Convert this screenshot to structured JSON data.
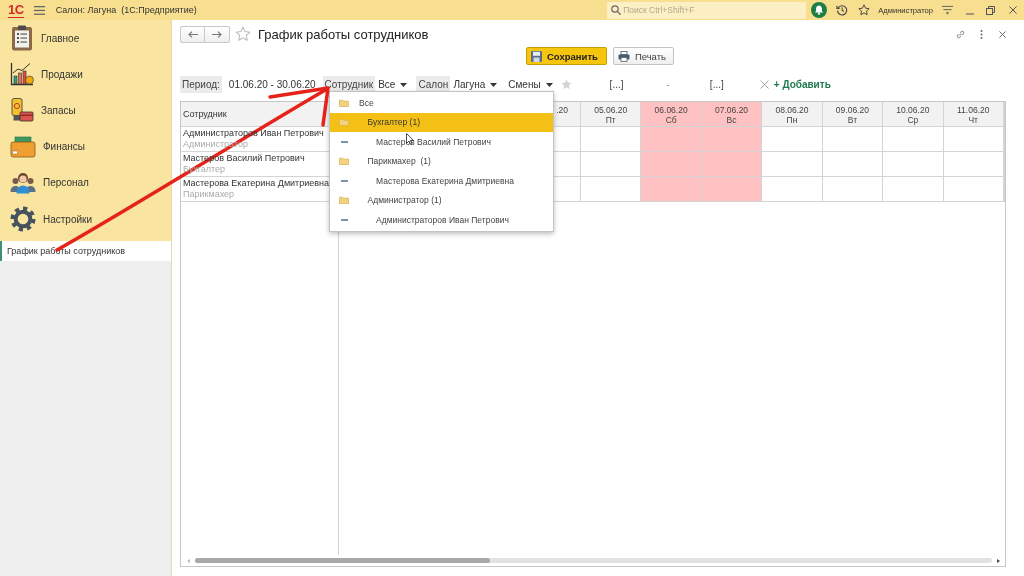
{
  "app_bar": {
    "logo": "1С",
    "title": "Салон: Лагуна  (1С:Предприятие)",
    "search": {
      "placeholder": "Поиск Ctrl+Shift+F"
    },
    "user": "Администратор"
  },
  "sections": [
    {
      "label": "Главное"
    },
    {
      "label": "Продажи"
    },
    {
      "label": "Запасы"
    },
    {
      "label": "Финансы"
    },
    {
      "label": "Персонал"
    },
    {
      "label": "Настройки"
    }
  ],
  "open_pages": [
    {
      "label": "График работы сотрудников",
      "selected": true
    }
  ],
  "form": {
    "title": "График работы сотрудников",
    "buttons": [
      {
        "label": "Сохранить",
        "kind": "save"
      },
      {
        "label": "Печать",
        "kind": "print"
      }
    ],
    "period": {
      "label": "Период:",
      "value": "01.06.20 - 30.06.20"
    },
    "selects": [
      {
        "label": "Сотрудник",
        "value": "Все"
      },
      {
        "label": "Салон",
        "value": "Лагуна"
      }
    ],
    "shifts_menu": "Смены",
    "range": {
      "from": "[...]",
      "separator": "-",
      "to": "[...]"
    },
    "add_link": "+ Добавить",
    "table": {
      "employee_header": "Сотрудник",
      "columns": [
        {
          "date": ".20",
          "kind": "partial",
          "weekend": false
        },
        {
          "date": "05.06.20",
          "day": "Пт",
          "kind": "day",
          "weekend": false
        },
        {
          "date": "06.06.20",
          "day": "Сб",
          "kind": "day",
          "weekend": true
        },
        {
          "date": "07.06.20",
          "day": "Вс",
          "kind": "day",
          "weekend": true
        },
        {
          "date": "08.06.20",
          "day": "Пн",
          "kind": "day",
          "weekend": false
        },
        {
          "date": "09.06.20",
          "day": "Вт",
          "kind": "day",
          "weekend": false
        },
        {
          "date": "10.06.20",
          "day": "Ср",
          "kind": "day",
          "weekend": false
        },
        {
          "date": "11.06.20",
          "day": "Чт",
          "kind": "day",
          "weekend": false
        }
      ],
      "rows": [
        {
          "name": "Администраторов Иван Петрович",
          "role": "Администратор"
        },
        {
          "name": "Мастеров Василий Петрович",
          "role": "Бухгалтер"
        },
        {
          "name": "Мастерова Екатерина Дмитриевна",
          "role": "Парикмахер"
        }
      ]
    },
    "employee_dropdown": {
      "items": [
        {
          "label": "Все",
          "kind": "group",
          "selected": false,
          "children": [
            {
              "label": "Бухгалтер (1)",
              "kind": "group",
              "selected": true,
              "children": [
                {
                  "label": "Мастеров Василий Петрович",
                  "kind": "employee",
                  "selected": false
                }
              ]
            },
            {
              "label": "Парикмахер  (1)",
              "kind": "group",
              "selected": false,
              "children": [
                {
                  "label": "Мастерова Екатерина Дмитриевна",
                  "kind": "employee",
                  "selected": false
                }
              ]
            },
            {
              "label": "Администратор (1)",
              "kind": "group",
              "selected": false,
              "children": [
                {
                  "label": "Администраторов Иван Петрович",
                  "kind": "employee",
                  "selected": false
                }
              ]
            }
          ]
        }
      ]
    }
  }
}
